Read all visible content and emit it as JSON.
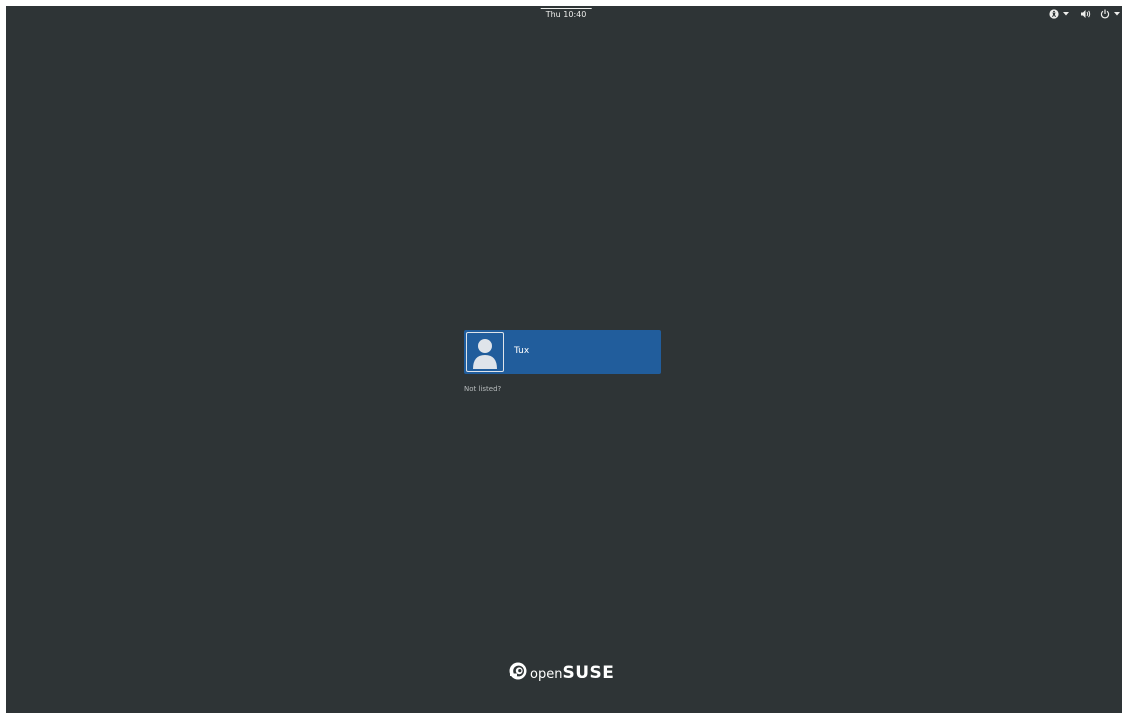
{
  "topbar": {
    "clock": "Thu 10:40",
    "icons": {
      "accessibility": "accessibility-icon",
      "volume": "volume-icon",
      "power": "power-icon",
      "menu_arrow": "chevron-down-icon"
    }
  },
  "user_list": {
    "users": [
      {
        "name": "Tux",
        "avatar": "user-avatar-icon"
      }
    ],
    "not_listed_label": "Not listed?"
  },
  "branding": {
    "logo_icon": "opensuse-logo-icon",
    "logo_prefix": "open",
    "logo_name": "SUSE"
  },
  "colors": {
    "background": "#2e3436",
    "selected_user": "#215d9c",
    "text": "#eeeeec"
  }
}
